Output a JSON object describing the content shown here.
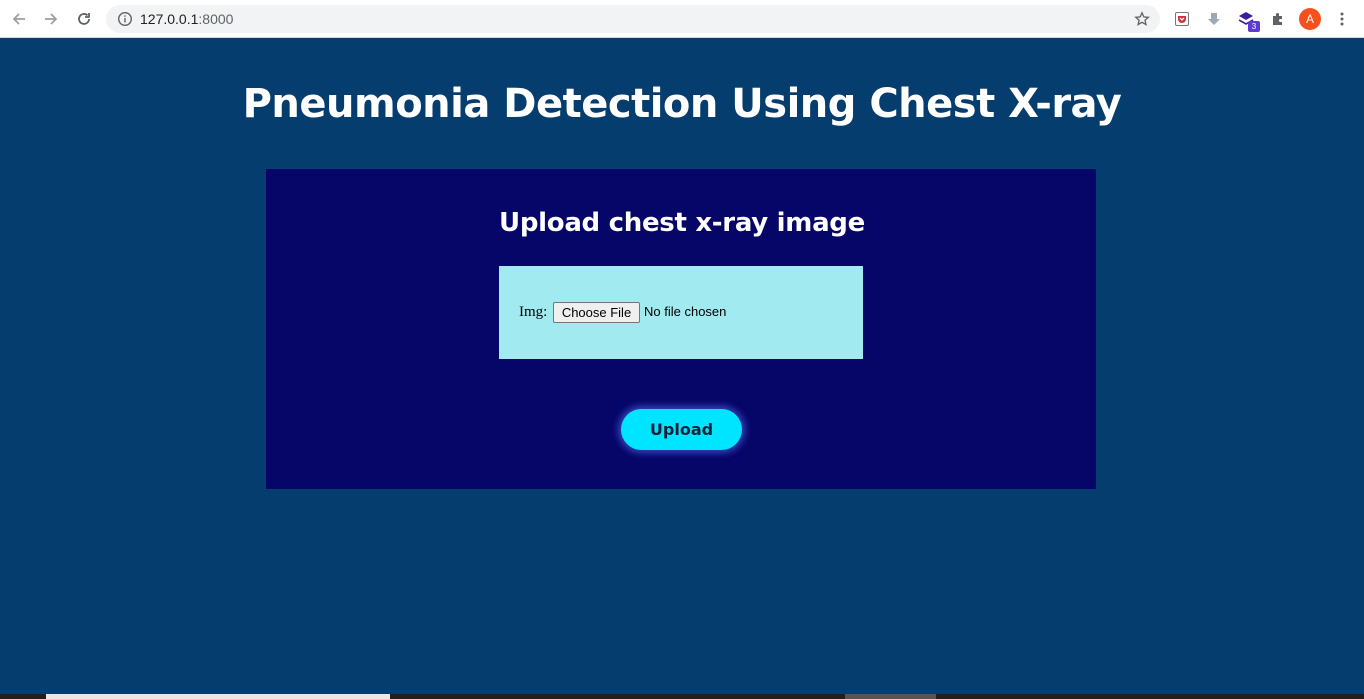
{
  "browser": {
    "url_host": "127.0.0.1",
    "url_port": ":8000",
    "profile_initial": "A",
    "extension_badge": "3"
  },
  "page": {
    "title": "Pneumonia Detection Using Chest X-ray",
    "card_heading": "Upload chest x-ray image",
    "img_label": "Img:",
    "choose_file_label": "Choose File",
    "no_file_text": "No file chosen",
    "upload_label": "Upload"
  },
  "colors": {
    "page_background": "#053d6e",
    "card_background": "#060668",
    "upload_box_background": "#a0eaf0",
    "upload_button": "#00e5ff"
  }
}
